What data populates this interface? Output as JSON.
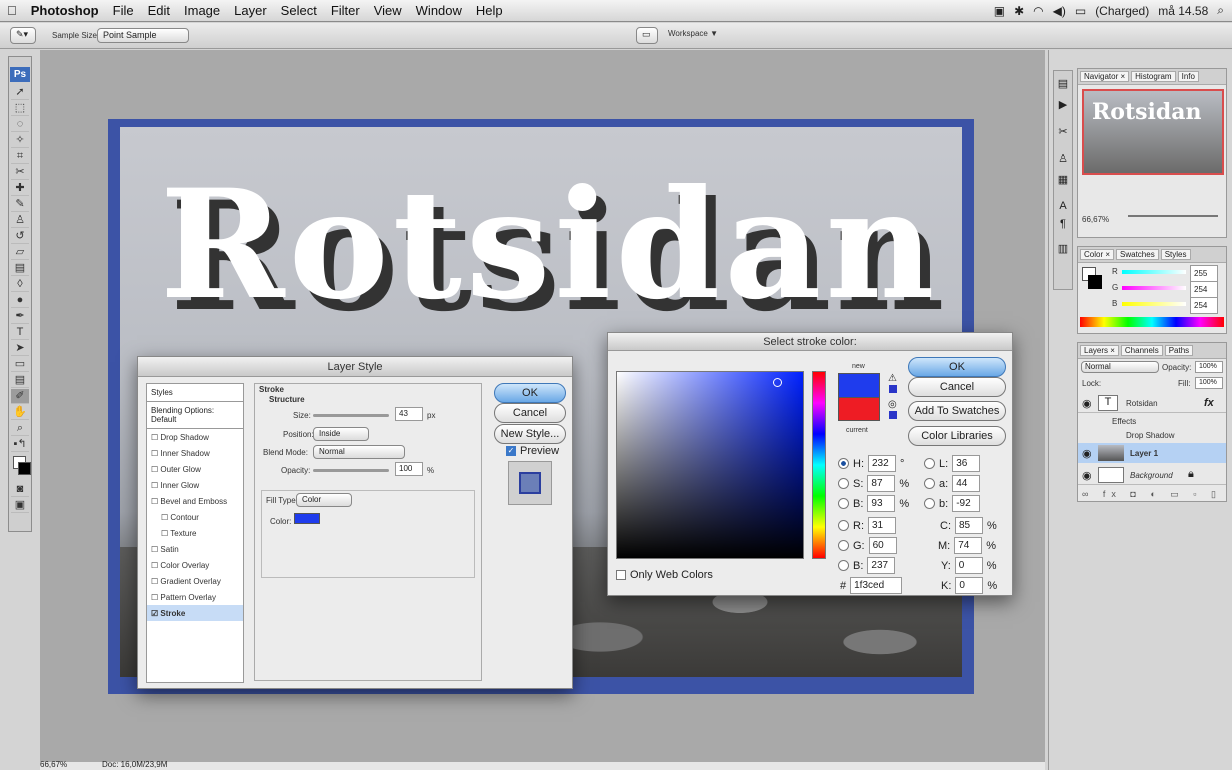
{
  "menubar": {
    "apple": "",
    "items": [
      "Photoshop",
      "File",
      "Edit",
      "Image",
      "Layer",
      "Select",
      "Filter",
      "View",
      "Window",
      "Help"
    ],
    "status": {
      "battery": "(Charged)",
      "clock": "må 14.58"
    }
  },
  "options": {
    "sample_size_label": "Sample Size:",
    "sample_size_value": "Point Sample",
    "workspace": "Workspace ▼"
  },
  "toolbox": {
    "logo": "Ps"
  },
  "canvas": {
    "text": "Rotsidan"
  },
  "status": {
    "zoom": "66,67%",
    "doc": "Doc: 16,0M/23,9M"
  },
  "layer_style": {
    "title": "Layer Style",
    "styles_header": "Styles",
    "items": [
      "Blending Options: Default",
      "Drop Shadow",
      "Inner Shadow",
      "Outer Glow",
      "Inner Glow",
      "Bevel and Emboss",
      "Contour",
      "Texture",
      "Satin",
      "Color Overlay",
      "Gradient Overlay",
      "Pattern Overlay",
      "Stroke"
    ],
    "stroke": {
      "group": "Stroke",
      "structure": "Structure",
      "size_label": "Size:",
      "size_value": "43",
      "size_unit": "px",
      "position_label": "Position:",
      "position_value": "Inside",
      "blend_label": "Blend Mode:",
      "blend_value": "Normal",
      "opacity_label": "Opacity:",
      "opacity_value": "100",
      "opacity_unit": "%",
      "fill_type_label": "Fill Type:",
      "fill_type_value": "Color",
      "color_label": "Color:",
      "color": "#1f3ced"
    },
    "buttons": {
      "ok": "OK",
      "cancel": "Cancel",
      "new_style": "New Style...",
      "preview": "Preview"
    }
  },
  "color_picker": {
    "title": "Select stroke color:",
    "new_label": "new",
    "current_label": "current",
    "only_web": "Only Web Colors",
    "buttons": {
      "ok": "OK",
      "cancel": "Cancel",
      "swatches": "Add To Swatches",
      "libraries": "Color Libraries"
    },
    "fields": {
      "H": "232",
      "S": "87",
      "B": "93",
      "R": "31",
      "G": "60",
      "Bv": "237",
      "L": "36",
      "a": "44",
      "b": "-92",
      "C": "85",
      "M": "74",
      "Y": "0",
      "K": "0",
      "hex": "1f3ced"
    },
    "units": {
      "deg": "°",
      "pct": "%"
    },
    "new_color": "#1f3ced",
    "current_color": "#ee1c24"
  },
  "navigator": {
    "tabs": [
      "Navigator ×",
      "Histogram",
      "Info"
    ],
    "thumb_text": "Rotsidan",
    "zoom": "66,67%"
  },
  "colorpanel": {
    "tabs": [
      "Color ×",
      "Swatches",
      "Styles"
    ],
    "R": "255",
    "G": "254",
    "B": "254",
    "R_label": "R",
    "G_label": "G",
    "B_label": "B"
  },
  "layers": {
    "tabs": [
      "Layers ×",
      "Channels",
      "Paths"
    ],
    "mode": "Normal",
    "opacity_label": "Opacity:",
    "opacity": "100%",
    "lock_label": "Lock:",
    "fill_label": "Fill:",
    "fill": "100%",
    "rows": [
      "Rotsidan",
      "Effects",
      "Drop Shadow",
      "Layer 1",
      "Background"
    ],
    "fx": "fx"
  }
}
